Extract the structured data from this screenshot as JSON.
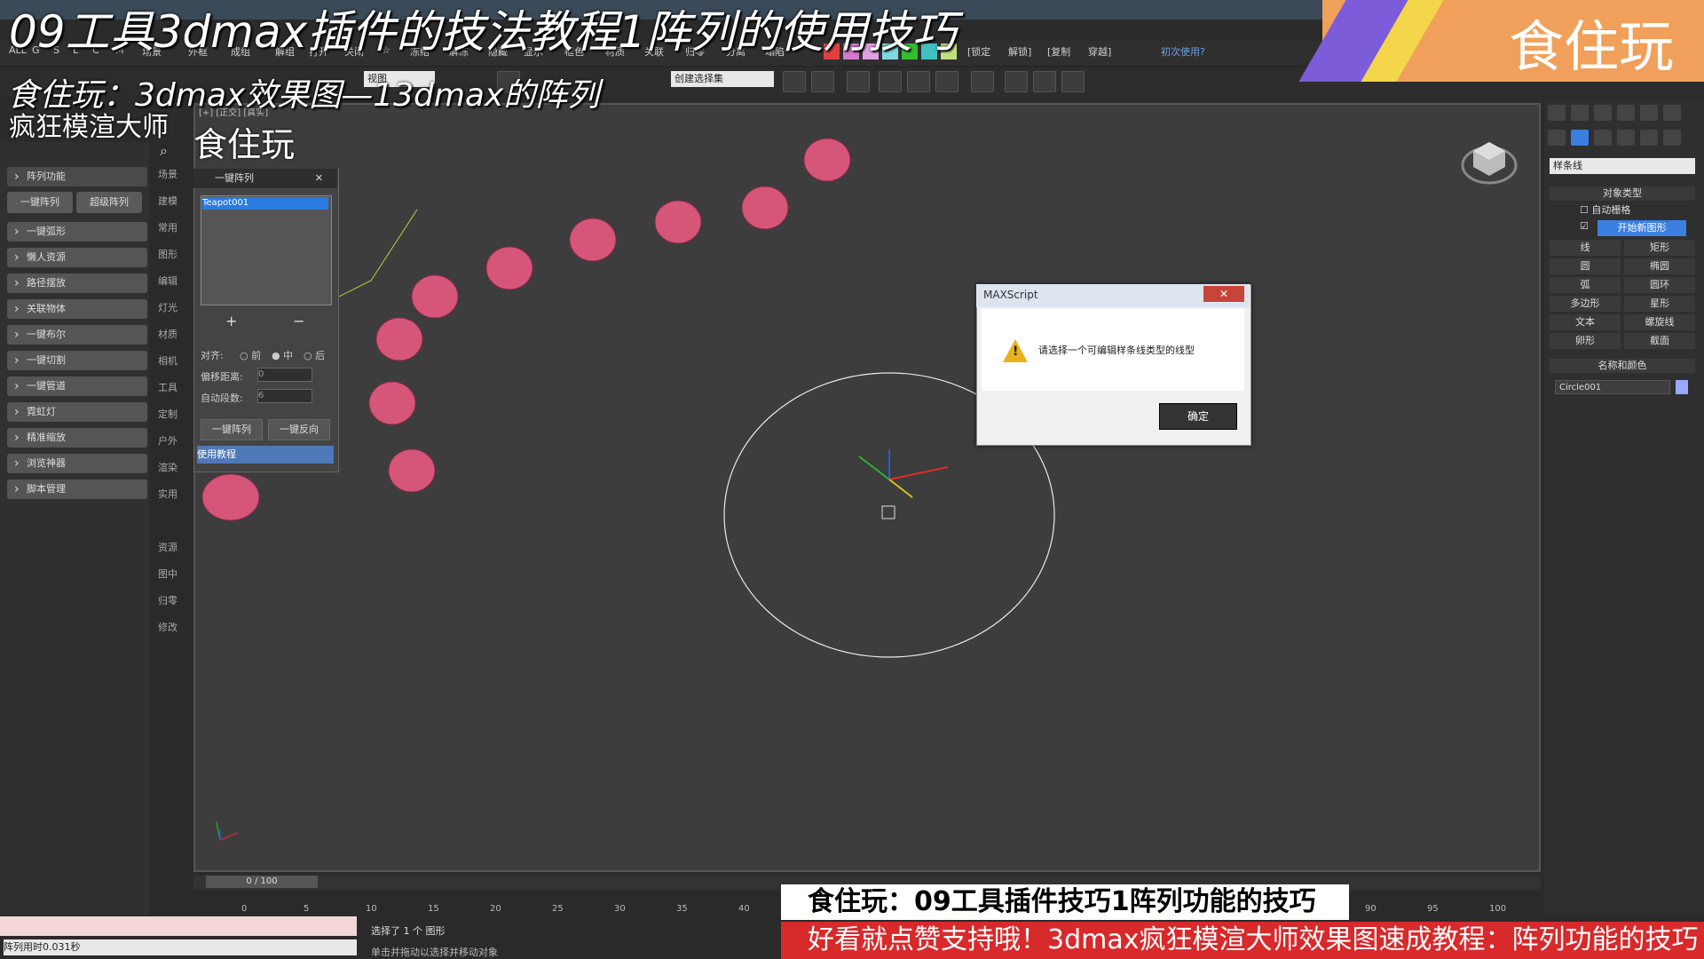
{
  "overlay": {
    "video_title": "09工具3dmax插件的技法教程1阵列的使用技巧",
    "video_subtitle": "食住玩：3dmax效果图—13dmax的阵列",
    "brand": "食住玩",
    "panel_title": "疯狂模渲大师",
    "viewport_watermark": "食住玩",
    "caption_main": "食住玩：09工具插件技巧1阵列功能的技巧",
    "caption_sub": "好看就点赞支持哦！3dmax疯狂模渲大师效果图速成教程：阵列功能的技巧"
  },
  "toolbar1": {
    "items": [
      "ALL",
      "G",
      "S",
      "L",
      "C",
      "M",
      "场景",
      "外框",
      "成组",
      "解组",
      "打开",
      "关闭",
      "☆",
      "冻结",
      "解冻",
      "隐藏",
      "显示",
      "框色",
      "材质",
      "关联",
      "归零",
      "分离",
      "塌陷"
    ],
    "right_items": [
      "[锁定",
      "解锁]",
      "[复制",
      "穿越]"
    ],
    "help_link": "初次使用?",
    "swatch_colors": [
      "#e04040",
      "#d07ad0",
      "#e0a0e0",
      "#80d8e0",
      "#30c030",
      "#40c0c0",
      "#c0e080"
    ]
  },
  "toolbar2": {
    "view_select": "视图",
    "selection_set": "创建选择集"
  },
  "left_panel": {
    "search_icon": "search-icon",
    "items": [
      "阵列功能",
      "一键弧形",
      "懒人资源",
      "路径摆放",
      "关联物体",
      "一键布尔",
      "一键切割",
      "一键管道",
      "霓虹灯",
      "精准缩放",
      "浏览神器",
      "脚本管理"
    ],
    "sub_buttons": [
      "一键阵列",
      "超级阵列"
    ],
    "tabs": [
      "场景",
      "建模",
      "常用",
      "图形",
      "编辑",
      "灯光",
      "材质",
      "相机",
      "工具",
      "定制",
      "户外",
      "渲染",
      "实用",
      "",
      "资源",
      "图中",
      "归零",
      "修改"
    ]
  },
  "viewport": {
    "label": "[+] [正交] [真实]"
  },
  "array_dialog": {
    "title": "一键阵列",
    "list_item": "Teapot001",
    "add": "+",
    "remove": "−",
    "align_label": "对齐:",
    "align_options": [
      "前",
      "中",
      "后"
    ],
    "offset_label": "偏移距离:",
    "offset_value": "0",
    "auto_seg_label": "自动段数:",
    "auto_seg_value": "6",
    "btn_array": "一键阵列",
    "btn_reverse": "一键反向",
    "footer": "使用教程"
  },
  "maxscript_dialog": {
    "title": "MAXScript",
    "close": "✕",
    "message": "请选择一个可编辑样条线类型的线型",
    "ok": "确定"
  },
  "right_panel": {
    "dropdown": "样条线",
    "object_type_header": "对象类型",
    "auto_grid": "自动栅格",
    "start_new_shape": "开始新图形",
    "shape_buttons": [
      "线",
      "矩形",
      "圆",
      "椭圆",
      "弧",
      "圆环",
      "多边形",
      "星形",
      "文本",
      "螺旋线",
      "卵形",
      "截面"
    ],
    "name_color_header": "名称和颜色",
    "object_name": "Circle001",
    "object_color": "#9aa8ff"
  },
  "timeline": {
    "slider": "0 / 100",
    "ticks": [
      "0",
      "5",
      "10",
      "15",
      "20",
      "25",
      "30",
      "35",
      "40",
      "90",
      "95",
      "100"
    ]
  },
  "status": {
    "left_text": "阵列用时0.031秒",
    "selection": "选择了 1 个 图形",
    "hint": "单击并拖动以选择并移动对象"
  }
}
